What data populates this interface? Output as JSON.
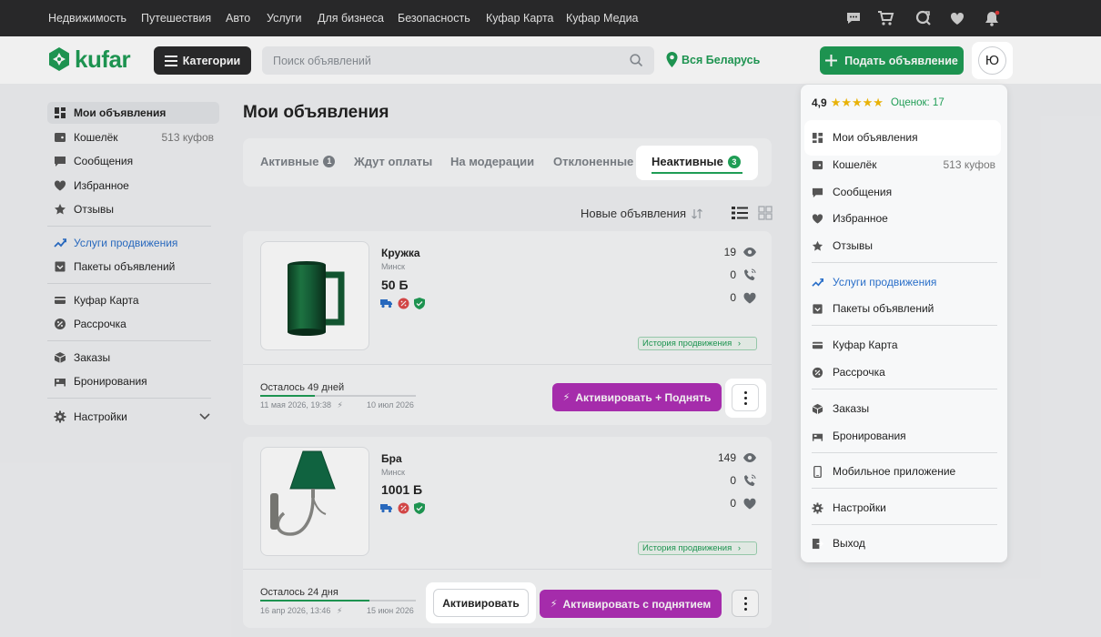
{
  "topnav": {
    "links": [
      "Недвижимость",
      "Путешествия",
      "Авто",
      "Услуги",
      "Для бизнеса",
      "Безопасность",
      "Куфар Карта",
      "Куфар Медиа"
    ],
    "icons": [
      "chat-icon",
      "cart-icon",
      "compare-icon",
      "heart-icon",
      "bell-icon"
    ]
  },
  "header": {
    "logo_text": "kufar",
    "categories_label": "Категории",
    "search_placeholder": "Поиск объявлений",
    "region_label": "Вся Беларусь",
    "post_label": "Подать объявление",
    "avatar_letter": "Ю"
  },
  "sidebar": {
    "items": [
      {
        "label": "Мои объявления",
        "icon": "grid-icon"
      },
      {
        "label": "Кошелёк",
        "count": "513 куфов",
        "icon": "wallet-icon"
      },
      {
        "label": "Сообщения",
        "icon": "message-icon"
      },
      {
        "label": "Избранное",
        "icon": "heart-icon"
      },
      {
        "label": "Отзывы",
        "icon": "star-icon"
      },
      {
        "label": "Услуги продвижения",
        "icon": "trend-icon"
      },
      {
        "label": "Пакеты объявлений",
        "icon": "package-icon"
      },
      {
        "label": "Куфар Карта",
        "icon": "card-icon"
      },
      {
        "label": "Рассрочка",
        "icon": "percent-icon"
      },
      {
        "label": "Заказы",
        "icon": "box-icon"
      },
      {
        "label": "Бронирования",
        "icon": "bed-icon"
      },
      {
        "label": "Настройки",
        "icon": "gear-icon"
      }
    ]
  },
  "main": {
    "title": "Мои объявления",
    "tabs": [
      {
        "label": "Активные",
        "badge": "1"
      },
      {
        "label": "Ждут оплаты"
      },
      {
        "label": "На модерации"
      },
      {
        "label": "Отклоненные"
      },
      {
        "label": "Неактивные",
        "badge": "3"
      }
    ],
    "sort_label": "Новые объявления",
    "listings": [
      {
        "name": "Кружка",
        "city": "Минск",
        "price": "50 Б",
        "views": "19",
        "calls": "0",
        "favorites": "0",
        "history_label": "История продвижения",
        "remaining": "Осталось 49 дней",
        "remaining_fraction": 0.35,
        "date_from": "11 мая 2026, 19:38",
        "date_to": "10 июл 2026",
        "promo_label": "Активировать + Поднять"
      },
      {
        "name": "Бра",
        "city": "Минск",
        "price": "1001 Б",
        "views": "149",
        "calls": "0",
        "favorites": "0",
        "history_label": "История продвижения",
        "remaining": "Осталось 24 дня",
        "remaining_fraction": 0.7,
        "date_from": "16 апр 2026, 13:46",
        "date_to": "15 июн 2026",
        "activate_label": "Активировать",
        "promo_label": "Активировать с поднятием"
      }
    ]
  },
  "dropdown": {
    "rating": "4,9",
    "stars": "★★★★★",
    "reviews": "Оценок: 17",
    "items": [
      {
        "label": "Мои объявления",
        "icon": "grid-icon"
      },
      {
        "label": "Кошелёк",
        "count": "513 куфов",
        "icon": "wallet-icon"
      },
      {
        "label": "Сообщения",
        "icon": "message-icon"
      },
      {
        "label": "Избранное",
        "icon": "heart-icon"
      },
      {
        "label": "Отзывы",
        "icon": "star-icon"
      },
      {
        "label": "Услуги продвижения",
        "icon": "trend-icon"
      },
      {
        "label": "Пакеты объявлений",
        "icon": "package-icon"
      },
      {
        "label": "Куфар Карта",
        "icon": "card-icon"
      },
      {
        "label": "Рассрочка",
        "icon": "percent-icon"
      },
      {
        "label": "Заказы",
        "icon": "box-icon"
      },
      {
        "label": "Бронирования",
        "icon": "bed-icon"
      },
      {
        "label": "Мобильное приложение",
        "icon": "phone-icon"
      },
      {
        "label": "Настройки",
        "icon": "gear-icon"
      },
      {
        "label": "Выход",
        "icon": "logout-icon"
      }
    ]
  },
  "colors": {
    "brand_green": "#1f9d55",
    "promo_purple": "#b02fb6",
    "link_blue": "#2a6fc9",
    "topnav_bg": "#2b2b2c"
  }
}
